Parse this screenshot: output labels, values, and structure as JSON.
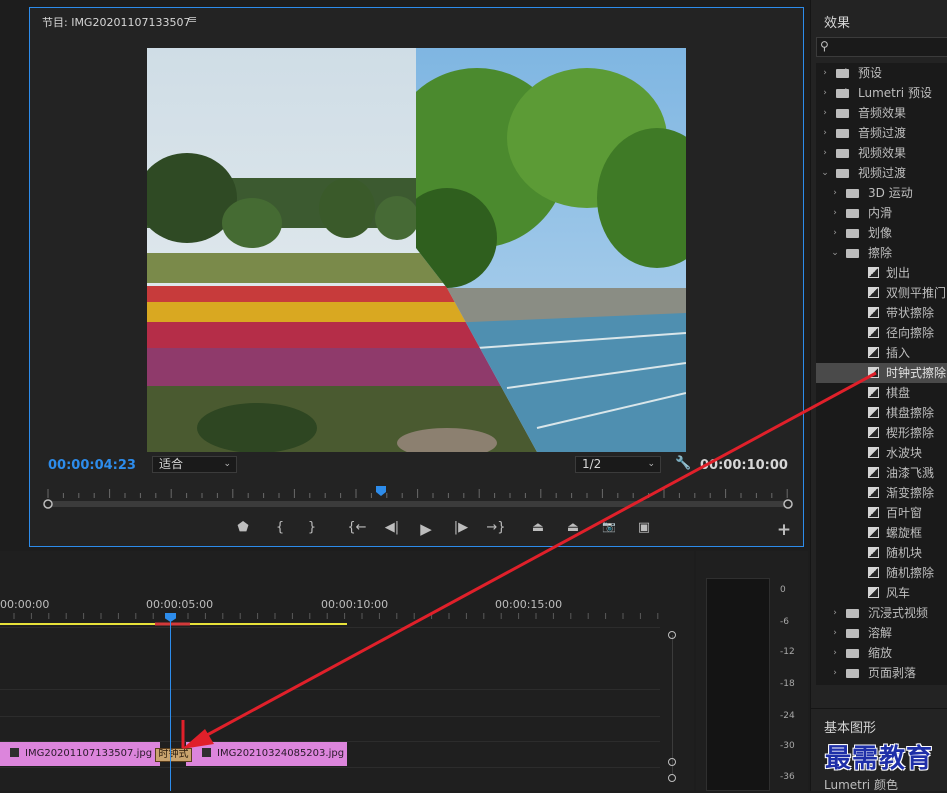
{
  "program_monitor": {
    "title": "节目: IMG20201107133507",
    "menu_icon": "hamburger-menu-icon",
    "current_time": "00:00:04:23",
    "fit_label": "适合",
    "resolution_label": "1/2",
    "duration": "00:00:10:00",
    "settings_icon": "wrench-icon",
    "playhead_position_fraction": 0.45,
    "controls": [
      {
        "name": "add-marker-icon",
        "glyph": "⬟"
      },
      {
        "name": "mark-in-icon",
        "glyph": "{"
      },
      {
        "name": "mark-out-icon",
        "glyph": "}"
      },
      {
        "name": "go-to-in-icon",
        "glyph": "{←"
      },
      {
        "name": "step-back-icon",
        "glyph": "◀|"
      },
      {
        "name": "play-icon",
        "glyph": "▶"
      },
      {
        "name": "step-forward-icon",
        "glyph": "|▶"
      },
      {
        "name": "go-to-out-icon",
        "glyph": "→}"
      },
      {
        "name": "lift-icon",
        "glyph": "⏏"
      },
      {
        "name": "extract-icon",
        "glyph": "⏏"
      },
      {
        "name": "export-frame-icon",
        "glyph": "📷"
      },
      {
        "name": "comparison-view-icon",
        "glyph": "▣"
      },
      {
        "name": "button-editor-icon",
        "glyph": "+"
      }
    ]
  },
  "effects_panel": {
    "title": "效果",
    "search_icon": "search-icon",
    "items": [
      {
        "label": "预设",
        "kind": "folder-star",
        "depth": 0,
        "expanded": false
      },
      {
        "label": "Lumetri 预设",
        "kind": "folder-star",
        "depth": 0,
        "expanded": false
      },
      {
        "label": "音频效果",
        "kind": "folder",
        "depth": 0,
        "expanded": false
      },
      {
        "label": "音频过渡",
        "kind": "folder",
        "depth": 0,
        "expanded": false
      },
      {
        "label": "视频效果",
        "kind": "folder",
        "depth": 0,
        "expanded": false
      },
      {
        "label": "视频过渡",
        "kind": "folder",
        "depth": 0,
        "expanded": true
      },
      {
        "label": "3D 运动",
        "kind": "folder",
        "depth": 1,
        "expanded": false
      },
      {
        "label": "内滑",
        "kind": "folder",
        "depth": 1,
        "expanded": false
      },
      {
        "label": "划像",
        "kind": "folder",
        "depth": 1,
        "expanded": false
      },
      {
        "label": "擦除",
        "kind": "folder",
        "depth": 1,
        "expanded": true
      },
      {
        "label": "划出",
        "kind": "effect",
        "depth": 2
      },
      {
        "label": "双侧平推门",
        "kind": "effect",
        "depth": 2
      },
      {
        "label": "带状擦除",
        "kind": "effect",
        "depth": 2
      },
      {
        "label": "径向擦除",
        "kind": "effect",
        "depth": 2
      },
      {
        "label": "插入",
        "kind": "effect",
        "depth": 2
      },
      {
        "label": "时钟式擦除",
        "kind": "effect",
        "depth": 2,
        "selected": true
      },
      {
        "label": "棋盘",
        "kind": "effect",
        "depth": 2
      },
      {
        "label": "棋盘擦除",
        "kind": "effect",
        "depth": 2
      },
      {
        "label": "楔形擦除",
        "kind": "effect",
        "depth": 2
      },
      {
        "label": "水波块",
        "kind": "effect",
        "depth": 2
      },
      {
        "label": "油漆飞溅",
        "kind": "effect",
        "depth": 2
      },
      {
        "label": "渐变擦除",
        "kind": "effect",
        "depth": 2
      },
      {
        "label": "百叶窗",
        "kind": "effect",
        "depth": 2
      },
      {
        "label": "螺旋框",
        "kind": "effect",
        "depth": 2
      },
      {
        "label": "随机块",
        "kind": "effect",
        "depth": 2
      },
      {
        "label": "随机擦除",
        "kind": "effect",
        "depth": 2
      },
      {
        "label": "风车",
        "kind": "effect",
        "depth": 2
      },
      {
        "label": "沉浸式视频",
        "kind": "folder",
        "depth": 1,
        "expanded": false
      },
      {
        "label": "溶解",
        "kind": "folder",
        "depth": 1,
        "expanded": false
      },
      {
        "label": "缩放",
        "kind": "folder",
        "depth": 1,
        "expanded": false
      },
      {
        "label": "页面剥落",
        "kind": "folder",
        "depth": 1,
        "expanded": false
      }
    ],
    "basic_graphics": "基本图形",
    "lumetri_color": "Lumetri 颜色",
    "watermark": "最需教育"
  },
  "timeline": {
    "ruler_labels": [
      "00:00:00",
      "00:00:05:00",
      "00:00:10:00",
      "00:00:15:00"
    ],
    "clip1_name": "IMG20201107133507.jpg",
    "clip2_name": "IMG20210324085203.jpg",
    "transition_label": "时钟式",
    "clip_icon": "image-clip-icon"
  },
  "audio_meter": {
    "db_labels": [
      "0",
      "-6",
      "-12",
      "-18",
      "-24",
      "-30",
      "-36"
    ]
  },
  "colors": {
    "accent": "#2d8ceb",
    "clip": "#dc85dc",
    "transition": "#c9a36e",
    "annotation_arrow": "#e0202a",
    "work_area": "#e8e23a"
  }
}
